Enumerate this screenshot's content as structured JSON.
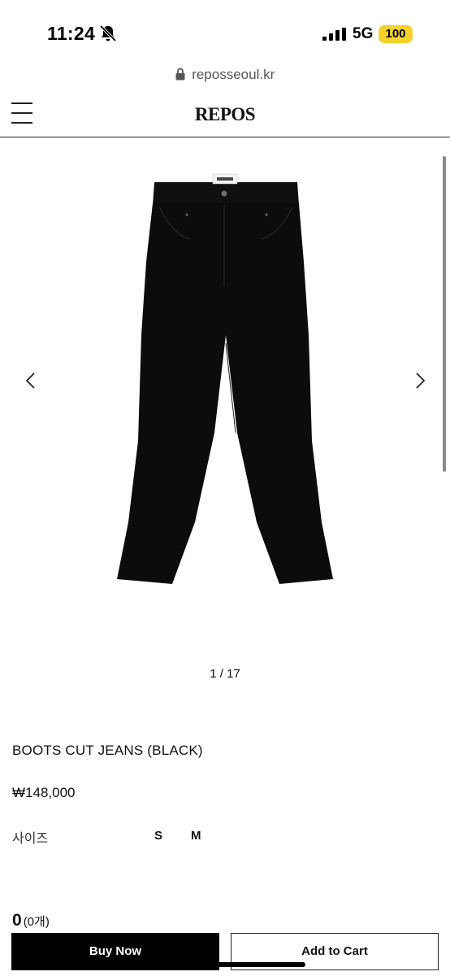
{
  "status_bar": {
    "time": "11:24",
    "network": "5G",
    "battery": "100",
    "icons": [
      "bell-off-icon",
      "signal-icon"
    ]
  },
  "browser": {
    "url": "reposseoul.kr",
    "icon": "lock-icon"
  },
  "header": {
    "logo": "REPOS",
    "menu_icon": "hamburger-menu-icon"
  },
  "gallery": {
    "counter": "1 / 17",
    "prev_icon": "chevron-left-icon",
    "next_icon": "chevron-right-icon",
    "image": "black-boots-cut-jeans-image"
  },
  "product": {
    "name": "BOOTS CUT JEANS (BLACK)",
    "price": "₩148,000",
    "size_label": "사이즈",
    "sizes": [
      "S",
      "M"
    ]
  },
  "order": {
    "total_amount": "0",
    "total_count": "(0개)",
    "buy_now_label": "Buy Now",
    "add_to_cart_label": "Add to Cart"
  },
  "colors": {
    "accent": "#000000",
    "battery": "#f5d22b",
    "background": "#ffffff"
  }
}
